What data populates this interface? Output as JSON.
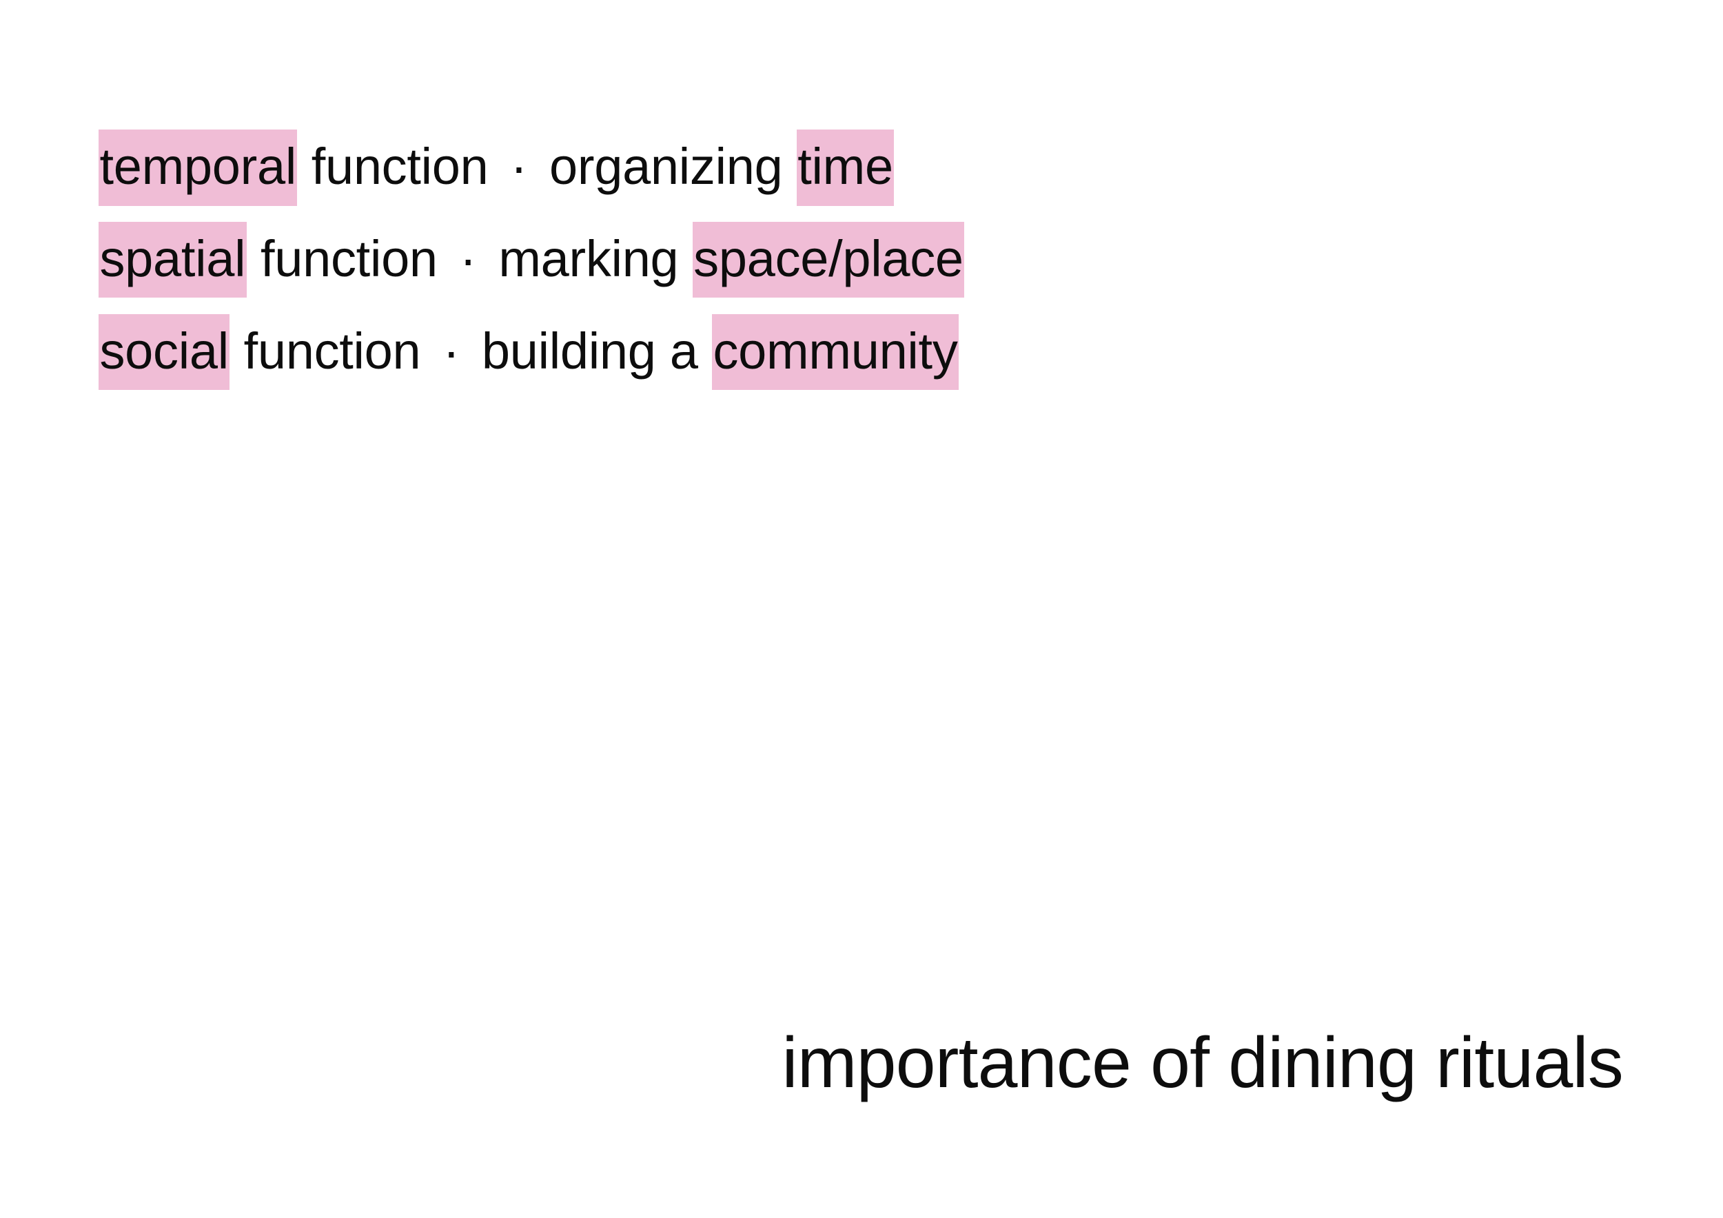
{
  "slide": {
    "background_color": "#ffffff",
    "text_color": "#0d0d0d",
    "highlight_color": "#f0bdd6",
    "title": "importance of dining rituals",
    "separator": "·",
    "bullets": [
      {
        "id": "temporal",
        "highlight_start": "temporal",
        "middle": " function ",
        "separator": "·",
        "tail": " organizing ",
        "highlight_end": "time",
        "full_text": "temporal function · organizing time"
      },
      {
        "id": "spatial",
        "highlight_start": "spatial",
        "middle": " function ",
        "separator": "·",
        "tail": " marking ",
        "highlight_end": "space/place",
        "full_text": "spatial function · marking space/place"
      },
      {
        "id": "social",
        "highlight_start": "social",
        "middle": " function ",
        "separator": "·",
        "tail": " building a ",
        "highlight_end": "community",
        "full_text": "social function · building a community"
      }
    ]
  }
}
